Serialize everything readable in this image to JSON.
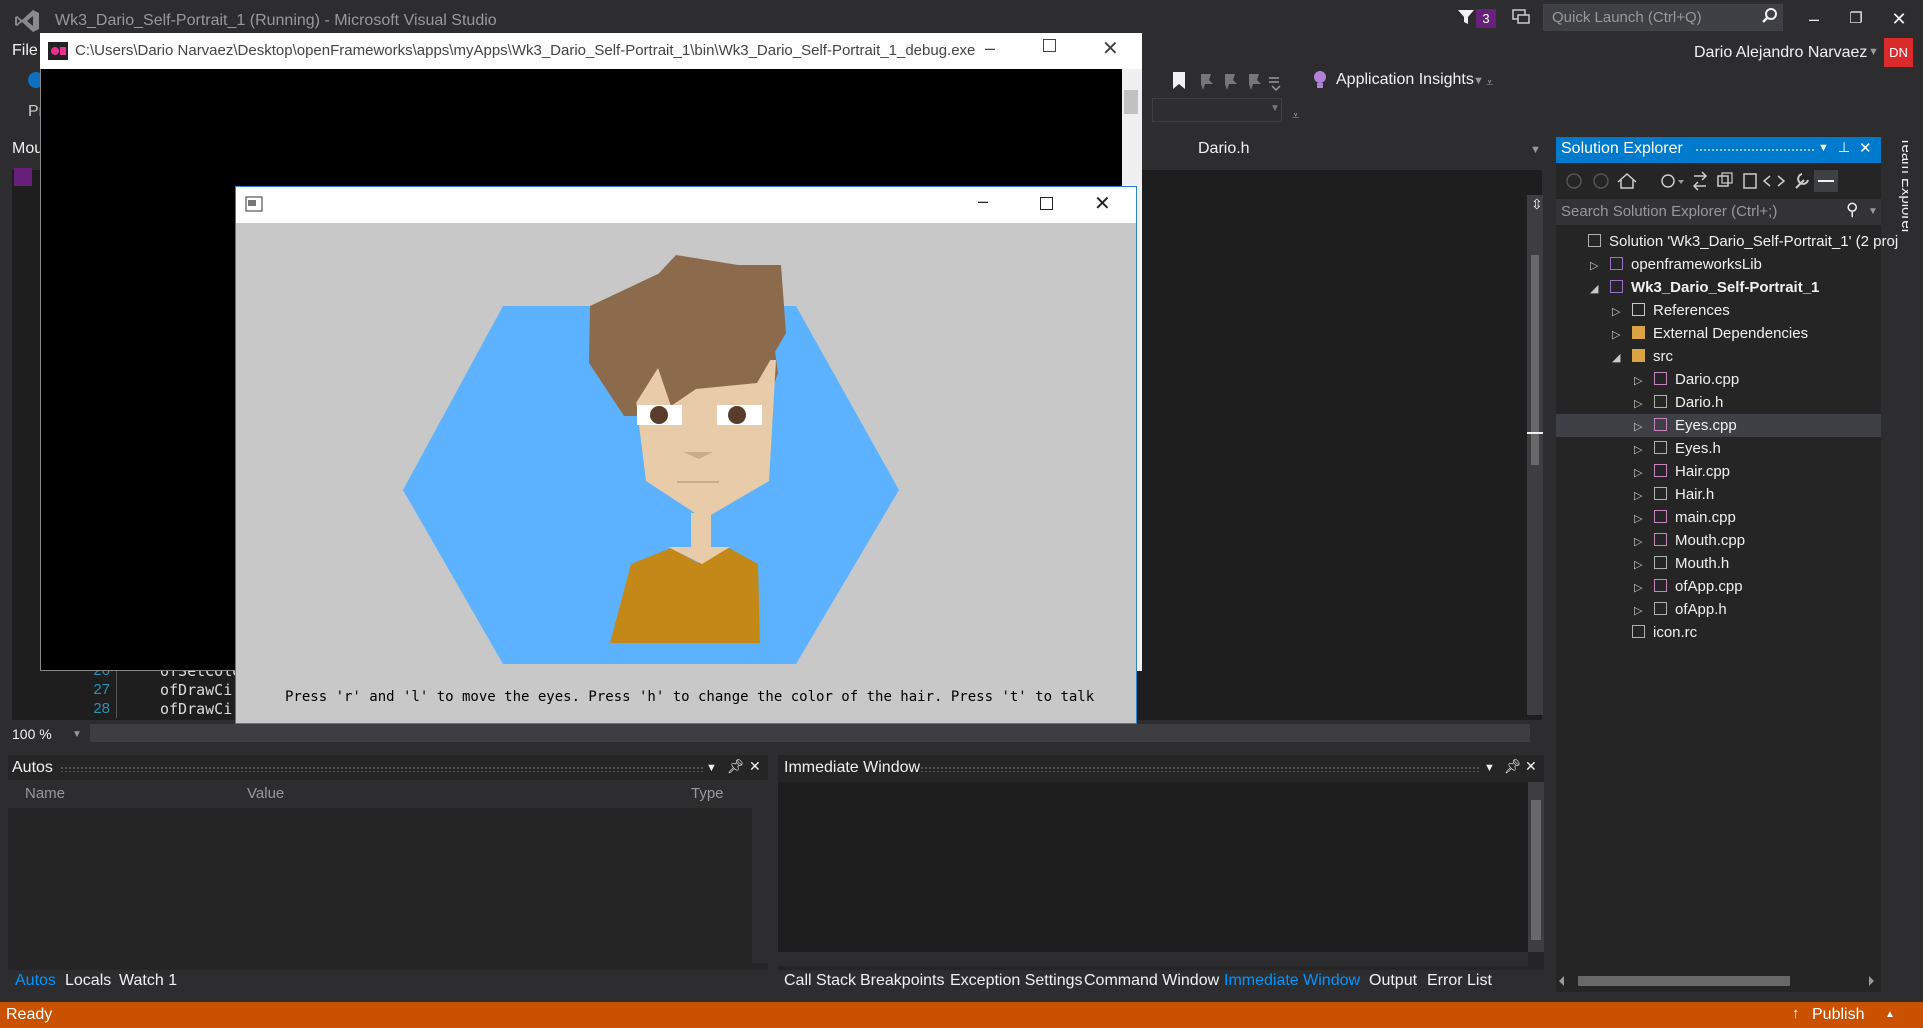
{
  "vs": {
    "window_title": "Wk3_Dario_Self-Portrait_1 (Running) - Microsoft Visual Studio",
    "notification_count": "3",
    "quick_launch_placeholder": "Quick Launch (Ctrl+Q)",
    "menu_file": "File",
    "user_name": "Dario Alejandro Narvaez",
    "user_initials": "DN",
    "app_insights": "Application Insights",
    "left_stub_pr": "Pr",
    "left_stub_mou": "Mou",
    "editor_tab": "Dario.h",
    "zoom": "100 %",
    "status": "Ready",
    "publish": "Publish",
    "accent_color": "#007acc",
    "status_color": "#ca5100"
  },
  "editor": {
    "lines": [
      {
        "num": "26",
        "code": "ofSetColo"
      },
      {
        "num": "27",
        "code": "ofDrawCi"
      },
      {
        "num": "28",
        "code": "ofDrawCi"
      }
    ]
  },
  "autos": {
    "title": "Autos",
    "columns": [
      "Name",
      "Value",
      "Type"
    ]
  },
  "immediate": {
    "title": "Immediate Window"
  },
  "bottom_tabs_left": [
    {
      "label": "Autos",
      "active": true
    },
    {
      "label": "Locals",
      "active": false
    },
    {
      "label": "Watch 1",
      "active": false
    }
  ],
  "bottom_tabs_right": [
    {
      "label": "Call Stack",
      "active": false
    },
    {
      "label": "Breakpoints",
      "active": false
    },
    {
      "label": "Exception Settings",
      "active": false
    },
    {
      "label": "Command Window",
      "active": false
    },
    {
      "label": "Immediate Window",
      "active": true
    },
    {
      "label": "Output",
      "active": false
    },
    {
      "label": "Error List",
      "active": false
    }
  ],
  "solution_explorer": {
    "title": "Solution Explorer",
    "search_placeholder": "Search Solution Explorer (Ctrl+;)",
    "team_explorer": "Team Explorer",
    "items": [
      {
        "label": "Solution 'Wk3_Dario_Self-Portrait_1' (2 proj",
        "icon": "solution-icon",
        "expander": "",
        "bold": false,
        "selected": false
      },
      {
        "label": "openframeworksLib",
        "icon": "project-icon",
        "expander": "▷",
        "bold": false,
        "selected": false
      },
      {
        "label": "Wk3_Dario_Self-Portrait_1",
        "icon": "project-icon",
        "expander": "◢",
        "bold": true,
        "selected": false
      },
      {
        "label": "References",
        "icon": "references-icon",
        "expander": "▷",
        "bold": false,
        "selected": false
      },
      {
        "label": "External Dependencies",
        "icon": "dependencies-icon",
        "expander": "▷",
        "bold": false,
        "selected": false
      },
      {
        "label": "src",
        "icon": "folder-icon",
        "expander": "◢",
        "bold": false,
        "selected": false
      },
      {
        "label": "Dario.cpp",
        "icon": "cpp-file-icon",
        "expander": "▷",
        "bold": false,
        "selected": false
      },
      {
        "label": "Dario.h",
        "icon": "header-file-icon",
        "expander": "▷",
        "bold": false,
        "selected": false
      },
      {
        "label": "Eyes.cpp",
        "icon": "cpp-file-icon",
        "expander": "▷",
        "bold": false,
        "selected": true
      },
      {
        "label": "Eyes.h",
        "icon": "header-file-icon",
        "expander": "▷",
        "bold": false,
        "selected": false
      },
      {
        "label": "Hair.cpp",
        "icon": "cpp-file-icon",
        "expander": "▷",
        "bold": false,
        "selected": false
      },
      {
        "label": "Hair.h",
        "icon": "header-file-icon",
        "expander": "▷",
        "bold": false,
        "selected": false
      },
      {
        "label": "main.cpp",
        "icon": "cpp-file-icon",
        "expander": "▷",
        "bold": false,
        "selected": false
      },
      {
        "label": "Mouth.cpp",
        "icon": "cpp-file-icon",
        "expander": "▷",
        "bold": false,
        "selected": false
      },
      {
        "label": "Mouth.h",
        "icon": "header-file-icon",
        "expander": "▷",
        "bold": false,
        "selected": false
      },
      {
        "label": "ofApp.cpp",
        "icon": "cpp-file-icon",
        "expander": "▷",
        "bold": false,
        "selected": false
      },
      {
        "label": "ofApp.h",
        "icon": "header-file-icon",
        "expander": "▷",
        "bold": false,
        "selected": false
      },
      {
        "label": "icon.rc",
        "icon": "resource-file-icon",
        "expander": "",
        "bold": false,
        "selected": false
      }
    ]
  },
  "console": {
    "path": "C:\\Users\\Dario Narvaez\\Desktop\\openFrameworks\\apps\\myApps\\Wk3_Dario_Self-Portrait_1\\bin\\Wk3_Dario_Self-Portrait_1_debug.exe"
  },
  "app": {
    "instructions": "Press 'r' and 'l' to move the eyes. Press 'h' to change the color of the hair. Press 't' to talk",
    "colors": {
      "background": "#c8c8c8",
      "hexagon": "#5db2ff",
      "skin": "#e8cba9",
      "hair": "#8c6a4c",
      "shirt": "#c48818",
      "eye_white": "#ffffff",
      "pupil": "#5a3c2c"
    }
  }
}
